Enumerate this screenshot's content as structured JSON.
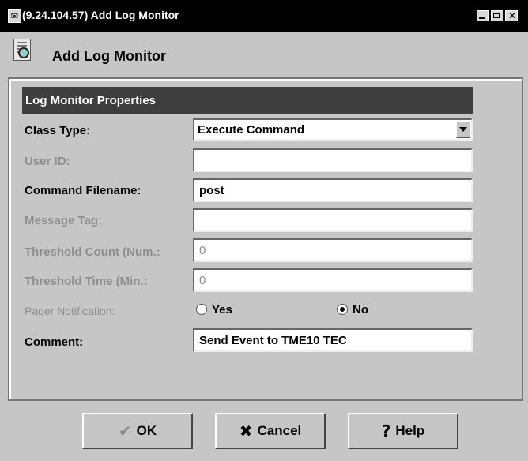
{
  "window": {
    "title": "(9.24.104.57) Add Log Monitor",
    "app_icon": "app-window-icon"
  },
  "header": {
    "title": "Add Log Monitor",
    "icon": "log-monitor-icon"
  },
  "section": {
    "title": "Log Monitor Properties"
  },
  "form": {
    "class_type": {
      "label": "Class Type:",
      "value": "Execute Command"
    },
    "user_id": {
      "label": "User ID:",
      "value": ""
    },
    "command_filename": {
      "label": "Command Filename:",
      "value": "post"
    },
    "message_tag": {
      "label": "Message Tag:",
      "value": ""
    },
    "threshold_count": {
      "label": "Threshold Count (Num.:",
      "value": "0"
    },
    "threshold_time": {
      "label": "Threshold Time (Min.:",
      "value": "0"
    },
    "pager_notification": {
      "label": "Pager Notification:",
      "options": [
        "Yes",
        "No"
      ],
      "selected": "No"
    },
    "comment": {
      "label": "Comment:",
      "value": "Send Event to TME10 TEC"
    }
  },
  "buttons": {
    "ok": "OK",
    "cancel": "Cancel",
    "help": "Help"
  },
  "colors": {
    "title_bar": "#000000",
    "section_header": "#3e3e3e",
    "background": "#c6c6c6",
    "disabled_text": "#8e8e8e"
  }
}
